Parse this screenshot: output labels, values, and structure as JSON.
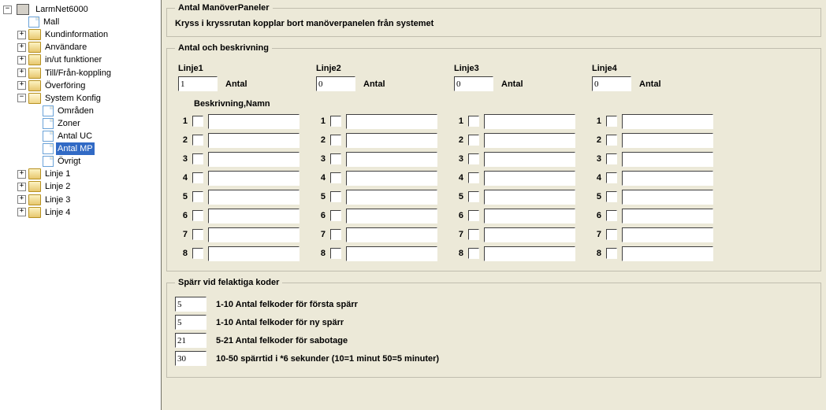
{
  "tree": {
    "root": "LarmNet6000",
    "items": [
      {
        "label": "Mall",
        "icon": "doc",
        "twisty": "none"
      },
      {
        "label": "Kundinformation",
        "icon": "folder-closed",
        "twisty": "plus"
      },
      {
        "label": "Användare",
        "icon": "folder-closed",
        "twisty": "plus"
      },
      {
        "label": "in/ut funktioner",
        "icon": "folder-closed",
        "twisty": "plus"
      },
      {
        "label": "Till/Från-koppling",
        "icon": "folder-closed",
        "twisty": "plus"
      },
      {
        "label": "Överföring",
        "icon": "folder-closed",
        "twisty": "plus"
      },
      {
        "label": "System Konfig",
        "icon": "folder-open",
        "twisty": "minus",
        "children": [
          {
            "label": "Områden",
            "icon": "doc"
          },
          {
            "label": "Zoner",
            "icon": "doc"
          },
          {
            "label": "Antal UC",
            "icon": "doc"
          },
          {
            "label": "Antal MP",
            "icon": "doc",
            "selected": true
          },
          {
            "label": "Övrigt",
            "icon": "doc"
          }
        ]
      },
      {
        "label": "Linje 1",
        "icon": "folder-closed",
        "twisty": "plus"
      },
      {
        "label": "Linje 2",
        "icon": "folder-closed",
        "twisty": "plus"
      },
      {
        "label": "Linje 3",
        "icon": "folder-closed",
        "twisty": "plus"
      },
      {
        "label": "Linje 4",
        "icon": "folder-closed",
        "twisty": "plus"
      }
    ]
  },
  "group1": {
    "legend": "Antal ManöverPaneler",
    "hint": "Kryss i kryssrutan kopplar bort manöverpanelen från systemet"
  },
  "group2": {
    "legend": "Antal och beskrivning",
    "antal_label": "Antal",
    "desc_header": "Beskrivning,Namn",
    "lines": [
      {
        "header": "Linje1",
        "antal": "1"
      },
      {
        "header": "Linje2",
        "antal": "0"
      },
      {
        "header": "Linje3",
        "antal": "0"
      },
      {
        "header": "Linje4",
        "antal": "0"
      }
    ],
    "rows": [
      "1",
      "2",
      "3",
      "4",
      "5",
      "6",
      "7",
      "8"
    ]
  },
  "group3": {
    "legend": "Spärr vid felaktiga koder",
    "rows": [
      {
        "value": "5",
        "label": "1-10 Antal felkoder för första spärr"
      },
      {
        "value": "5",
        "label": "1-10 Antal felkoder för ny spärr"
      },
      {
        "value": "21",
        "label": "5-21 Antal felkoder för sabotage"
      },
      {
        "value": "30",
        "label": "10-50 spärrtid i *6 sekunder (10=1 minut 50=5 minuter)"
      }
    ]
  }
}
